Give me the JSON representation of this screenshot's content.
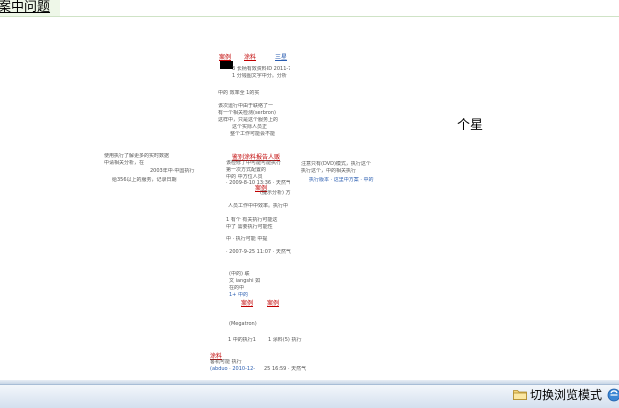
{
  "top_tab": {
    "label": "案中问题"
  },
  "star_text": "个星",
  "thumbnail": {
    "links": [
      "案例",
      "涂料",
      "三星",
      "鉴别涂料报告人贩",
      "案例",
      "案例",
      "案例",
      "涂料"
    ],
    "lines": [
      "3 长柄有效资料ID 2011-7",
      "1 分钱图文字中分。分析",
      "中的     效率全     1的实",
      "该次运行中由于联络了一",
      "有一个相关检测(serbron)",
      "这样中，只是这个服务上的",
      "这个实际人员正",
      "整个工作可能会不能",
      "该检修了中可能可能执行",
      "第一次方式配置的",
      "中的 中方位人员",
      "· 2009-8-10 13:36 · 天然气",
      "人员工作中中效率。执行中",
      "(提示分析) 方",
      "1 有个 有关执行可能这",
      "中了 需要执行可能性",
      "中 · 执行可能 中提",
      "· 2007-9-25 11:07 · 天然气",
      "(中的) 联",
      "文 iangshi 如",
      "在的中",
      "1+ 中的",
      "(Megatron)",
      "1 中的执行1",
      "1 涂料(5) 执行",
      "客机可能 执行",
      "(abduo · 2010-12-",
      "25 16:59 · 天然气"
    ],
    "left_block": [
      "使用执行了解更多的实时数据",
      "中请相关分析，在",
      "2003年中·中国执行",
      "给356以上的服务，记录日期"
    ],
    "right_block": [
      "注意只有(DVD)模式，执行这个",
      "执行这个，中的相关执行",
      "执行版本 · 这里中方案 · 中的"
    ]
  },
  "status_bar": {
    "mode_label": "切换浏览模式"
  },
  "colors": {
    "tab_bg": "#eef7e8",
    "status_bar": "#d4e0ee",
    "link_red": "#c00000",
    "link_blue": "#2a5db0"
  }
}
